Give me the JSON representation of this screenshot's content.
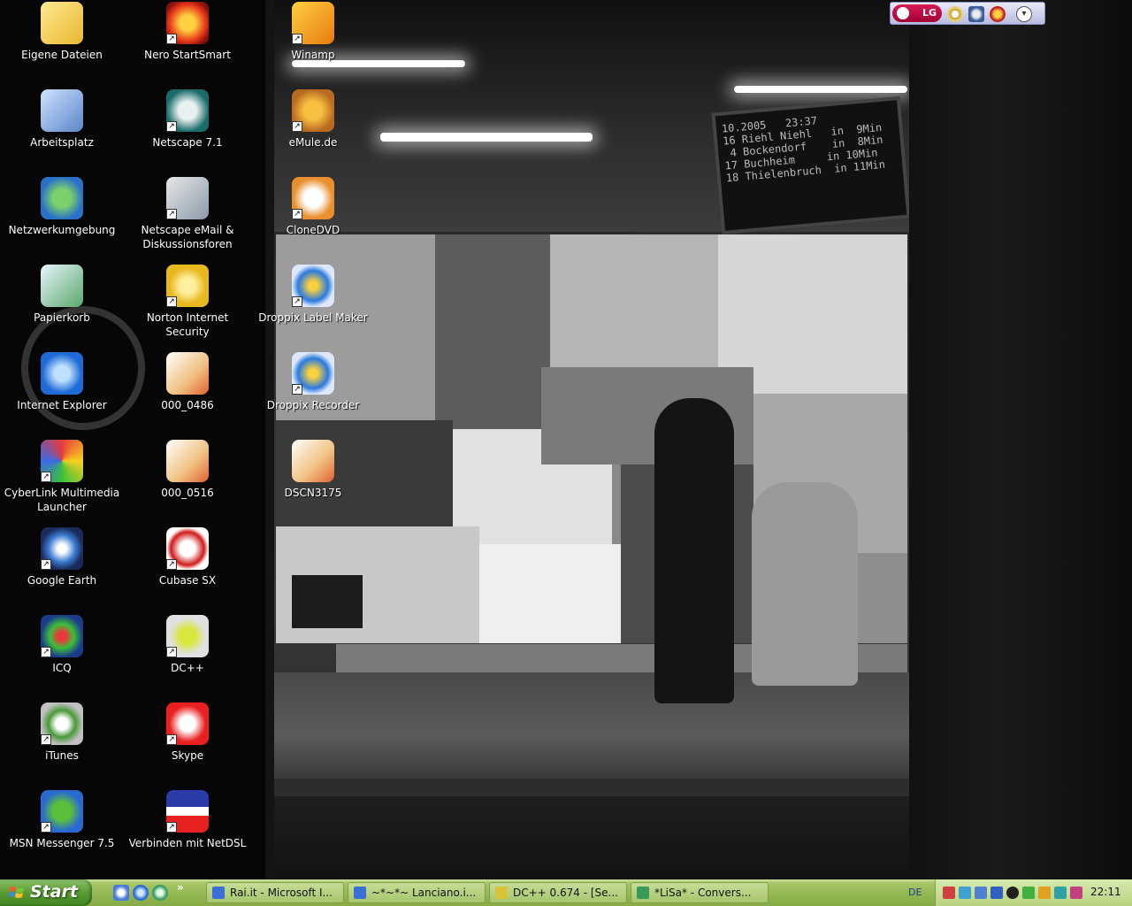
{
  "desktop": {
    "icons": [
      {
        "label": "Eigene Dateien",
        "icon": "my-documents-folder-icon",
        "shortcut": false
      },
      {
        "label": "Arbeitsplatz",
        "icon": "my-computer-icon",
        "shortcut": false
      },
      {
        "label": "Netzwerkumgebung",
        "icon": "network-places-icon",
        "shortcut": false
      },
      {
        "label": "Papierkorb",
        "icon": "recycle-bin-icon",
        "shortcut": false
      },
      {
        "label": "Internet Explorer",
        "icon": "internet-explorer-icon",
        "shortcut": false
      },
      {
        "label": "CyberLink Multimedia\nLauncher",
        "icon": "cyberlink-icon",
        "shortcut": true
      },
      {
        "label": "Google Earth",
        "icon": "google-earth-icon",
        "shortcut": true
      },
      {
        "label": "ICQ",
        "icon": "icq-flower-icon",
        "shortcut": true
      },
      {
        "label": "iTunes",
        "icon": "itunes-icon",
        "shortcut": true
      },
      {
        "label": "MSN Messenger 7.5",
        "icon": "msn-messenger-icon",
        "shortcut": true
      },
      {
        "label": "Nero StartSmart",
        "icon": "nero-flame-icon",
        "shortcut": true
      },
      {
        "label": "Netscape 7.1",
        "icon": "netscape-icon",
        "shortcut": true
      },
      {
        "label": "Netscape eMail &\nDiskussionsforen",
        "icon": "netscape-mail-icon",
        "shortcut": true
      },
      {
        "label": "Norton Internet Security",
        "icon": "norton-globe-icon",
        "shortcut": true
      },
      {
        "label": "000_0486",
        "icon": "image-file-icon",
        "shortcut": false
      },
      {
        "label": "000_0516",
        "icon": "image-file-icon",
        "shortcut": false
      },
      {
        "label": "Cubase SX",
        "icon": "cubase-icon",
        "shortcut": true
      },
      {
        "label": "DC++",
        "icon": "dcpp-icon",
        "shortcut": true
      },
      {
        "label": "Skype",
        "icon": "skype-icon",
        "shortcut": true
      },
      {
        "label": "Verbinden mit NetDSL",
        "icon": "netcologne-icon",
        "shortcut": true
      },
      {
        "label": "Winamp",
        "icon": "winamp-bolt-icon",
        "shortcut": true
      },
      {
        "label": "eMule.de",
        "icon": "emule-mule-icon",
        "shortcut": true
      },
      {
        "label": "CloneDVD",
        "icon": "clonedvd-sheep-icon",
        "shortcut": true
      },
      {
        "label": "Droppix Label Maker",
        "icon": "droppix-figure-icon",
        "shortcut": true
      },
      {
        "label": "Droppix Recorder",
        "icon": "droppix-figure-icon",
        "shortcut": true
      },
      {
        "label": "DSCN3175",
        "icon": "image-file-icon",
        "shortcut": false
      }
    ]
  },
  "wallpaper": {
    "departure_board": [
      "10.2005   23:37",
      "16 Riehl Niehl   in  9Min",
      " 4 Bockendorf    in  8Min",
      "17 Buchheim     in 10Min",
      "18 Thielenbruch  in 11Min"
    ]
  },
  "lg_toolbar": {
    "logo": "LG"
  },
  "taskbar": {
    "start_label": "Start",
    "quick_launch_more": "»",
    "tasks": [
      {
        "label": "Rai.it - Microsoft I...",
        "icon": "ie-page-icon",
        "color": "#3a6fd8"
      },
      {
        "label": "~*~*~ Lanciano.i...",
        "icon": "ie-page-icon",
        "color": "#3a6fd8"
      },
      {
        "label": "DC++ 0.674 - [Se...",
        "icon": "dcpp-icon",
        "color": "#d8c23a"
      },
      {
        "label": "*LiSa* - Convers...",
        "icon": "chat-icon",
        "color": "#3a9a5a"
      }
    ],
    "language": "DE",
    "clock": "22:11"
  },
  "colors": {
    "taskbar": "#95b955",
    "start": "#4a8f2a",
    "desktop": "#060606"
  }
}
